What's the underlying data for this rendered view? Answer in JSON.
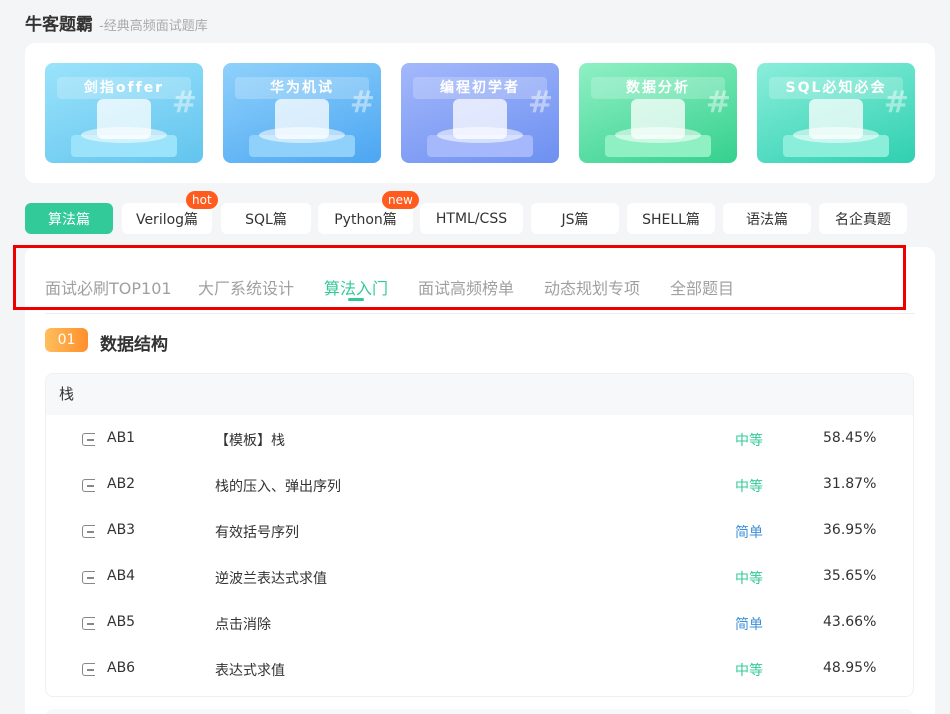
{
  "header": {
    "title": "牛客题霸",
    "subtitle": "-经典高频面试题库"
  },
  "banners": [
    {
      "title": "剑指offer",
      "bg": "#63c4ee",
      "accent": "#9ae3fb"
    },
    {
      "title": "华为机试",
      "bg": "#4ca6f2",
      "accent": "#8fd1fb"
    },
    {
      "title": "编程初学者",
      "bg": "#6d90f0",
      "accent": "#a4b8fb"
    },
    {
      "title": "数据分析",
      "bg": "#35d08e",
      "accent": "#8ff0c4"
    },
    {
      "title": "SQL必知必会",
      "bg": "#2fd0b0",
      "accent": "#8aeedb"
    }
  ],
  "categories": [
    {
      "label": "算法篇",
      "tag": "",
      "active": true
    },
    {
      "label": "Verilog篇",
      "tag": "hot",
      "active": false
    },
    {
      "label": "SQL篇",
      "tag": "",
      "active": false
    },
    {
      "label": "Python篇",
      "tag": "new",
      "active": false
    },
    {
      "label": "HTML/CSS",
      "tag": "",
      "active": false
    },
    {
      "label": "JS篇",
      "tag": "",
      "active": false
    },
    {
      "label": "SHELL篇",
      "tag": "",
      "active": false
    },
    {
      "label": "语法篇",
      "tag": "",
      "active": false
    },
    {
      "label": "名企真题",
      "tag": "",
      "active": false
    }
  ],
  "sub_tabs": [
    {
      "label": "面试必刷TOP101",
      "active": false
    },
    {
      "label": "大厂系统设计",
      "active": false
    },
    {
      "label": "算法入门",
      "active": true
    },
    {
      "label": "面试高频榜单",
      "active": false
    },
    {
      "label": "动态规划专项",
      "active": false
    },
    {
      "label": "全部题目",
      "active": false
    }
  ],
  "section": {
    "number": "01",
    "title": "数据结构"
  },
  "topic": {
    "name": "栈",
    "questions": [
      {
        "id": "AB1",
        "title": "【模板】栈",
        "difficulty": "中等",
        "difficulty_color": "#32ca99",
        "pass_rate": "58.45%"
      },
      {
        "id": "AB2",
        "title": "栈的压入、弹出序列",
        "difficulty": "中等",
        "difficulty_color": "#32ca99",
        "pass_rate": "31.87%"
      },
      {
        "id": "AB3",
        "title": "有效括号序列",
        "difficulty": "简单",
        "difficulty_color": "#3f8fd8",
        "pass_rate": "36.95%"
      },
      {
        "id": "AB4",
        "title": "逆波兰表达式求值",
        "difficulty": "中等",
        "difficulty_color": "#32ca99",
        "pass_rate": "35.65%"
      },
      {
        "id": "AB5",
        "title": "点击消除",
        "difficulty": "简单",
        "difficulty_color": "#3f8fd8",
        "pass_rate": "43.66%"
      },
      {
        "id": "AB6",
        "title": "表达式求值",
        "difficulty": "中等",
        "difficulty_color": "#32ca99",
        "pass_rate": "48.95%"
      }
    ]
  },
  "colors": {
    "accent": "#32ca99",
    "tag": "#ff5b1f",
    "highlight": "#ee0000"
  }
}
